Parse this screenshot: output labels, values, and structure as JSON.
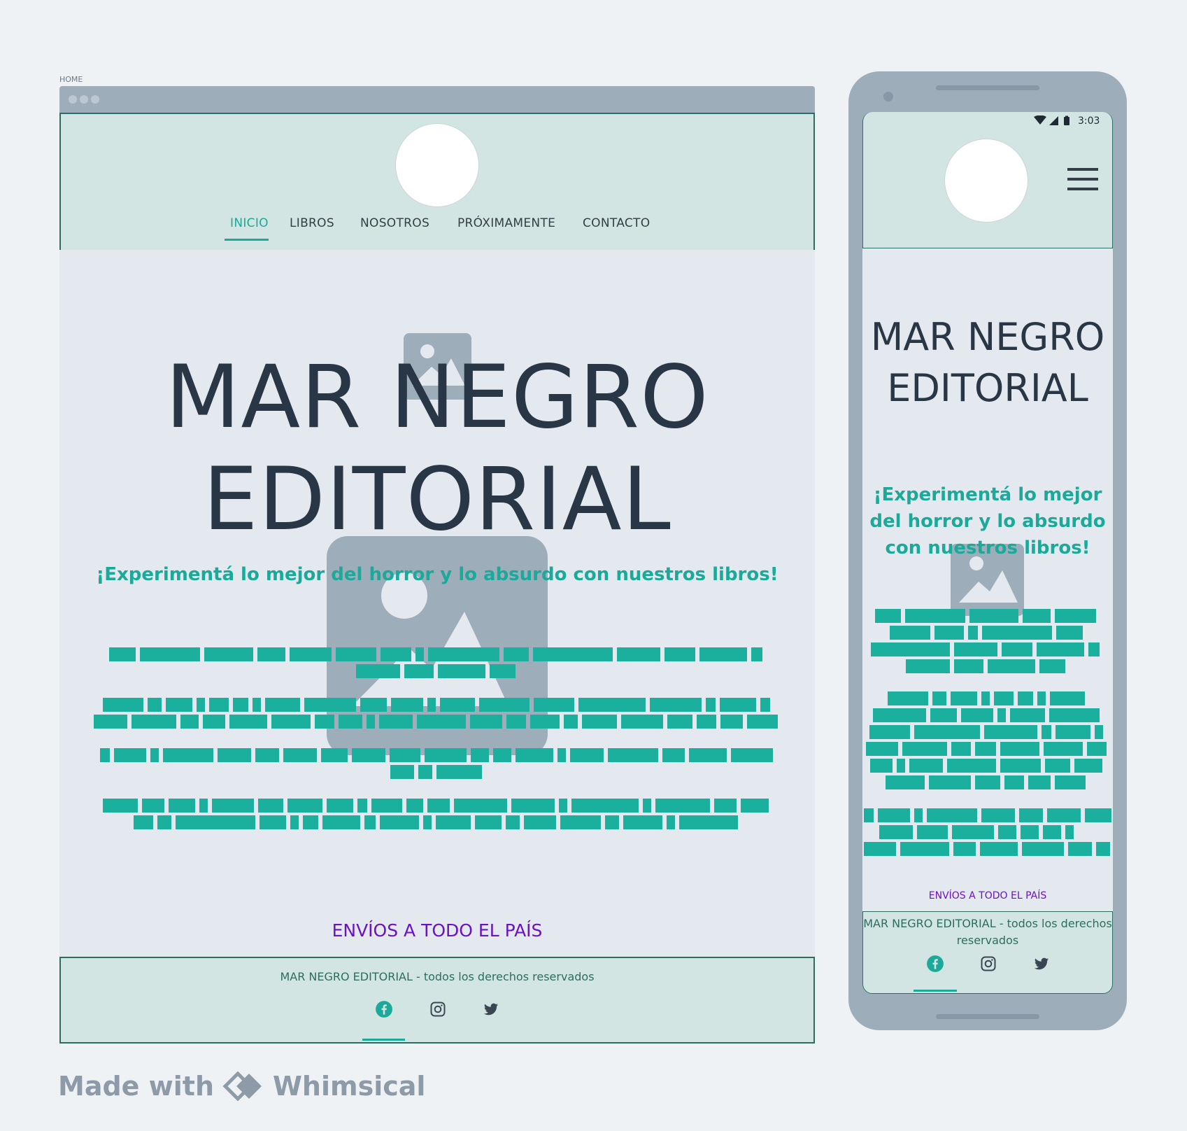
{
  "desktop": {
    "frame_label": "HOME",
    "nav": [
      {
        "label": "INICIO",
        "active": true
      },
      {
        "label": "LIBROS"
      },
      {
        "label": "NOSOTROS"
      },
      {
        "label": "PRÓXIMAMENTE"
      },
      {
        "label": "CONTACTO"
      }
    ],
    "title_line1": "MAR NEGRO",
    "title_line2": "EDITORIAL",
    "tagline": "¡Experimentá lo mejor del horror y lo absurdo con nuestros libros!",
    "shipping": "ENVÍOS A TODO EL PAÍS",
    "footer_copy": "MAR NEGRO EDITORIAL - todos los derechos reservados",
    "social": [
      "facebook-icon",
      "instagram-icon",
      "twitter-icon"
    ]
  },
  "mobile": {
    "status_time": "3:03",
    "title_line1": "MAR NEGRO",
    "title_line2": "EDITORIAL",
    "tagline": "¡Experimentá lo mejor del horror y lo absurdo con nuestros libros!",
    "shipping": "ENVÍOS A TODO EL PAÍS",
    "footer_copy": "MAR NEGRO EDITORIAL - todos los derechos reservados",
    "social": [
      "facebook-icon",
      "instagram-icon",
      "twitter-icon"
    ]
  },
  "colors": {
    "accent": "#1ba99a",
    "dark_text": "#283645",
    "header_bg": "#d2e5e2",
    "border": "#2b6e60",
    "shipping": "#6a13c4",
    "placeholder": "#9eadba"
  },
  "brand": {
    "prefix": "Made with",
    "name": "Whimsical"
  }
}
